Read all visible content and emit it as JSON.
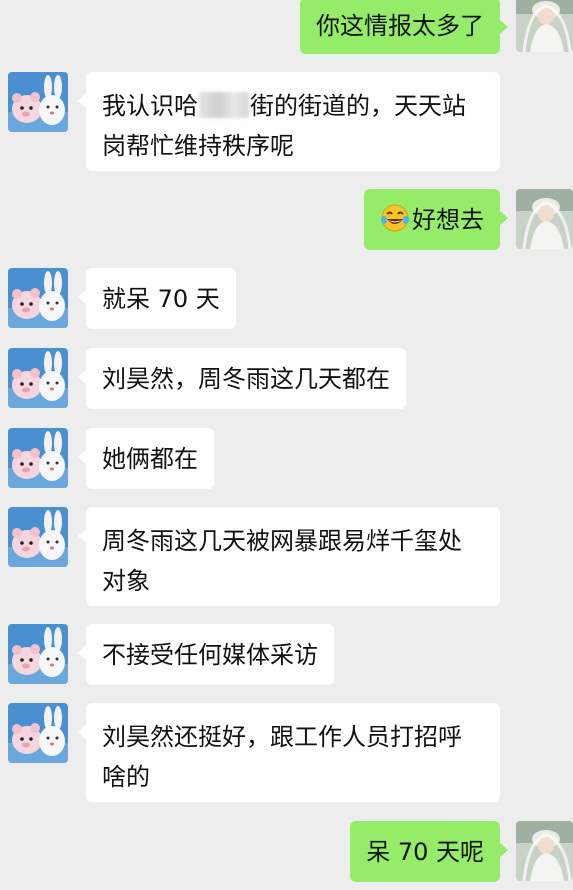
{
  "messages": [
    {
      "side": "right",
      "lines": [
        "你这情报太多了"
      ]
    },
    {
      "side": "left",
      "line1_a": "我认识哈",
      "line1_b": "街的街道的，天天站",
      "line2": "岗帮忙维持秩序呢"
    },
    {
      "side": "right",
      "emoji": "laughing-tears-emoji",
      "text": "好想去"
    },
    {
      "side": "left",
      "lines": [
        "就呆 70 天"
      ]
    },
    {
      "side": "left",
      "lines": [
        "刘昊然，周冬雨这几天都在"
      ]
    },
    {
      "side": "left",
      "lines": [
        "她俩都在"
      ]
    },
    {
      "side": "left",
      "lines": [
        "周冬雨这几天被网暴跟易烊千玺处",
        "对象"
      ]
    },
    {
      "side": "left",
      "lines": [
        "不接受任何媒体采访"
      ]
    },
    {
      "side": "left",
      "lines": [
        "刘昊然还挺好，跟工作人员打招呼",
        "啥的"
      ]
    },
    {
      "side": "right",
      "lines": [
        "呆 70 天呢"
      ]
    }
  ],
  "avatars": {
    "left": "bunny-plush-avatar",
    "right": "bride-photo-avatar"
  },
  "colors": {
    "background": "#ededed",
    "sent_bubble": "#95ec69",
    "received_bubble": "#ffffff"
  }
}
